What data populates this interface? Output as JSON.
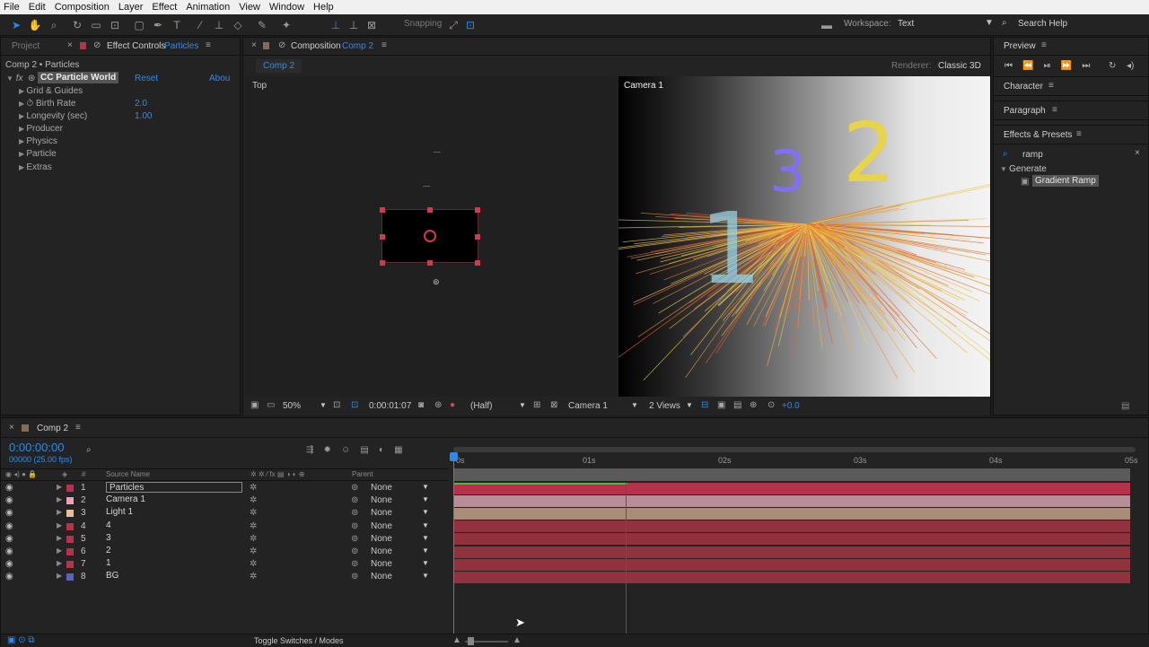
{
  "menu": [
    "File",
    "Edit",
    "Composition",
    "Layer",
    "Effect",
    "Animation",
    "View",
    "Window",
    "Help"
  ],
  "toolbar": {
    "snapping": "Snapping",
    "workspace_label": "Workspace:",
    "workspace_value": "Text",
    "search_help": "Search Help"
  },
  "left_panel": {
    "tab_project": "Project",
    "tab_effect_controls": "Effect Controls",
    "tab_effect_layer": "Particles",
    "breadcrumb": "Comp 2 • Particles",
    "effect_name": "CC Particle World",
    "reset": "Reset",
    "about": "Abou",
    "props": [
      {
        "label": "Grid & Guides",
        "value": ""
      },
      {
        "label": "Birth Rate",
        "value": "2.0"
      },
      {
        "label": "Longevity (sec)",
        "value": "1.00"
      },
      {
        "label": "Producer",
        "value": ""
      },
      {
        "label": "Physics",
        "value": ""
      },
      {
        "label": "Particle",
        "value": ""
      },
      {
        "label": "Extras",
        "value": ""
      }
    ]
  },
  "comp_panel": {
    "tab_label": "Composition",
    "tab_comp": "Comp 2",
    "comp_tab": "Comp 2",
    "renderer_label": "Renderer:",
    "renderer_value": "Classic 3D",
    "view_left": "Top",
    "view_right": "Camera 1",
    "footer": {
      "zoom": "50%",
      "timecode": "0:00:01:07",
      "resolution": "(Half)",
      "camera": "Camera 1",
      "views": "2 Views",
      "exposure": "+0.0"
    },
    "numbers": [
      "1",
      "3",
      "2"
    ]
  },
  "right_panels": {
    "preview": "Preview",
    "character": "Character",
    "paragraph": "Paragraph",
    "effects_presets": "Effects & Presets",
    "search_value": "ramp",
    "category": "Generate",
    "result": "Gradient Ramp"
  },
  "timeline": {
    "tab": "Comp 2",
    "timecode": "0:00:00:00",
    "fps": "00000 (25.00 fps)",
    "col_number": "#",
    "col_source": "Source Name",
    "col_parent": "Parent",
    "ruler": [
      "0s",
      "01s",
      "02s",
      "03s",
      "04s",
      "05s"
    ],
    "footer": "Toggle Switches / Modes",
    "layers": [
      {
        "num": "1",
        "name": "Particles",
        "parent": "None",
        "color": "#b5344a",
        "bar": "#b6324a"
      },
      {
        "num": "2",
        "name": "Camera 1",
        "parent": "None",
        "color": "#e8a2b8",
        "bar": "#b58e98"
      },
      {
        "num": "3",
        "name": "Light 1",
        "parent": "None",
        "color": "#e6c09a",
        "bar": "#a88e78"
      },
      {
        "num": "4",
        "name": "4",
        "parent": "None",
        "color": "#b5344a",
        "bar": "#92323f"
      },
      {
        "num": "5",
        "name": "3",
        "parent": "None",
        "color": "#b5344a",
        "bar": "#92323f"
      },
      {
        "num": "6",
        "name": "2",
        "parent": "None",
        "color": "#b5344a",
        "bar": "#92323f"
      },
      {
        "num": "7",
        "name": "1",
        "parent": "None",
        "color": "#b5344a",
        "bar": "#92323f"
      },
      {
        "num": "8",
        "name": "BG",
        "parent": "None",
        "color": "#5a64b8",
        "bar": "#92323f"
      }
    ]
  }
}
